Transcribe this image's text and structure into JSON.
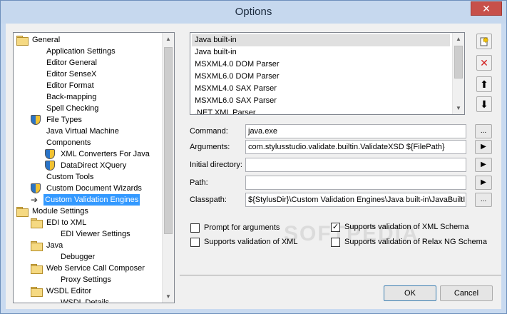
{
  "window": {
    "title": "Options",
    "close_glyph": "✕"
  },
  "tree": {
    "items": [
      {
        "label": "General",
        "icon": "folder-icon",
        "level": 0
      },
      {
        "label": "Application Settings",
        "icon": "",
        "level": 2
      },
      {
        "label": "Editor General",
        "icon": "",
        "level": 2
      },
      {
        "label": "Editor SenseX",
        "icon": "",
        "level": 2
      },
      {
        "label": "Editor Format",
        "icon": "",
        "level": 2
      },
      {
        "label": "Back-mapping",
        "icon": "",
        "level": 2
      },
      {
        "label": "Spell Checking",
        "icon": "",
        "level": 2
      },
      {
        "label": "File Types",
        "icon": "shield-icon",
        "level": 1
      },
      {
        "label": "Java Virtual Machine",
        "icon": "",
        "level": 2
      },
      {
        "label": "Components",
        "icon": "",
        "level": 2
      },
      {
        "label": "XML Converters For Java",
        "icon": "shield-icon",
        "level": 2
      },
      {
        "label": "DataDirect XQuery",
        "icon": "shield-icon",
        "level": 2
      },
      {
        "label": "Custom Tools",
        "icon": "",
        "level": 2
      },
      {
        "label": "Custom Document Wizards",
        "icon": "shield-icon",
        "level": 1
      },
      {
        "label": "Custom Validation Engines",
        "icon": "arrow-icon",
        "level": 1,
        "selected": true
      },
      {
        "label": "Module Settings",
        "icon": "folder-icon",
        "level": 0
      },
      {
        "label": "EDI to XML",
        "icon": "folder-icon",
        "level": 1
      },
      {
        "label": "EDI Viewer Settings",
        "icon": "",
        "level": 3
      },
      {
        "label": "Java",
        "icon": "folder-icon",
        "level": 1
      },
      {
        "label": "Debugger",
        "icon": "",
        "level": 3
      },
      {
        "label": "Web Service Call Composer",
        "icon": "folder-icon",
        "level": 1
      },
      {
        "label": "Proxy Settings",
        "icon": "",
        "level": 3
      },
      {
        "label": "WSDL Editor",
        "icon": "folder-icon",
        "level": 1
      },
      {
        "label": "WSDL Details",
        "icon": "",
        "level": 3
      }
    ]
  },
  "engines": {
    "items": [
      {
        "label": "Java built-in",
        "selected": true
      },
      {
        "label": "Java built-in"
      },
      {
        "label": "MSXML4.0 DOM Parser"
      },
      {
        "label": "MSXML6.0 DOM Parser"
      },
      {
        "label": "MSXML4.0 SAX Parser"
      },
      {
        "label": "MSXML6.0 SAX Parser"
      },
      {
        "label": ".NET XML Parser"
      }
    ],
    "buttons": {
      "new_icon": "new-document-icon",
      "delete_icon": "delete-x-icon",
      "up_icon": "move-up-icon",
      "down_icon": "move-down-icon"
    }
  },
  "fields": {
    "command": {
      "label": "Command:",
      "value": "java.exe",
      "button": "..."
    },
    "arguments": {
      "label": "Arguments:",
      "value": "com.stylusstudio.validate.builtin.ValidateXSD ${FilePath}",
      "button": "▶"
    },
    "initial_directory": {
      "label": "Initial directory:",
      "value": "",
      "button": "▶"
    },
    "path": {
      "label": "Path:",
      "value": "",
      "button": "▶"
    },
    "classpath": {
      "label": "Classpath:",
      "value": "${StylusDir}\\Custom Validation Engines\\Java built-in\\JavaBuiltIn",
      "button": "..."
    }
  },
  "checkboxes": {
    "prompt_args": {
      "label": "Prompt for arguments",
      "checked": false
    },
    "validate_xml": {
      "label": "Supports validation of XML",
      "checked": false
    },
    "validate_xml_schema": {
      "label": "Supports validation of XML Schema",
      "checked": true
    },
    "validate_relax_ng": {
      "label": "Supports validation of Relax NG Schema",
      "checked": false
    }
  },
  "dialog_buttons": {
    "ok": "OK",
    "cancel": "Cancel"
  },
  "watermark": "SOFTPEDIA",
  "colors": {
    "selection": "#3399ff",
    "title_bar": "#c6d8ee",
    "close_button": "#c7504a"
  }
}
